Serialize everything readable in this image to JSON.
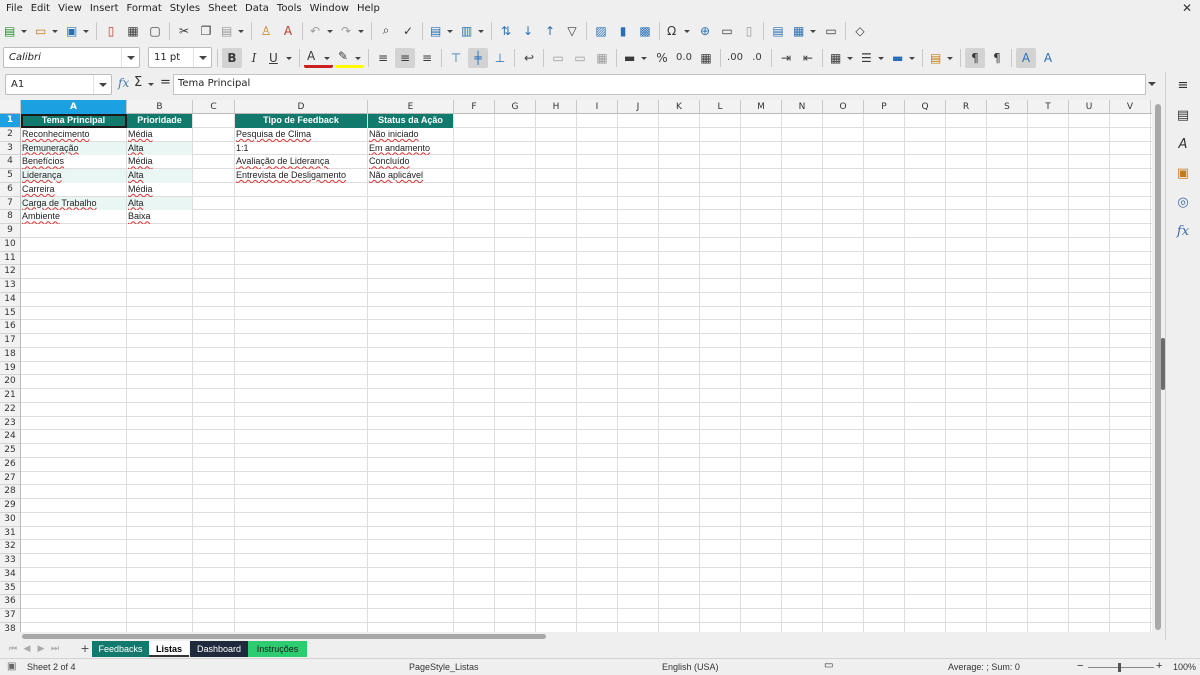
{
  "menu": [
    "File",
    "Edit",
    "View",
    "Insert",
    "Format",
    "Styles",
    "Sheet",
    "Data",
    "Tools",
    "Window",
    "Help"
  ],
  "close_glyph": "✕",
  "font": {
    "name": "Calibri",
    "size": "11 pt"
  },
  "name_box": "A1",
  "formula": {
    "fx": "fx",
    "sum": "Σ",
    "equals": "=",
    "content": "Tema Principal"
  },
  "columns": [
    "A",
    "B",
    "C",
    "D",
    "E",
    "F",
    "G",
    "H",
    "I",
    "J",
    "K",
    "L",
    "M",
    "N",
    "O",
    "P",
    "Q",
    "R",
    "S",
    "T",
    "U",
    "V"
  ],
  "row_count": 38,
  "selected": {
    "column": "A",
    "row": 1
  },
  "table1": {
    "headers": [
      "Tema Principal",
      "Prioridade"
    ],
    "rows": [
      [
        "Reconhecimento",
        "Média"
      ],
      [
        "Remuneração",
        "Alta"
      ],
      [
        "Benefícios",
        "Média"
      ],
      [
        "Liderança",
        "Alta"
      ],
      [
        "Carreira",
        "Média"
      ],
      [
        "Carga de Trabalho",
        "Alta"
      ],
      [
        "Ambiente",
        "Baixa"
      ]
    ]
  },
  "table2": {
    "headers": [
      "Tipo de Feedback",
      "Status da Ação"
    ],
    "rows": [
      [
        "Pesquisa de Clima",
        "Não iniciado"
      ],
      [
        "1:1",
        "Em andamento"
      ],
      [
        "Avaliação de Liderança",
        "Concluído"
      ],
      [
        "Entrevista de Desligamento",
        "Não aplicável"
      ]
    ]
  },
  "colors": {
    "header_fill": "#127a6d",
    "band_fill": "#eaf6f4",
    "selection": "#1ba1e2"
  },
  "sheet_tabs": [
    {
      "name": "Feedbacks",
      "bg": "#127a6d",
      "fg": "#ffffff",
      "active": false
    },
    {
      "name": "Listas",
      "bg": "#ffffff",
      "fg": "#000000",
      "active": true
    },
    {
      "name": "Dashboard",
      "bg": "#1f2a3c",
      "fg": "#ffffff",
      "active": false
    },
    {
      "name": "Instruções",
      "bg": "#2ecc71",
      "fg": "#1a1a1a",
      "active": false
    }
  ],
  "status": {
    "sheet": "Sheet 2 of 4",
    "page_style": "PageStyle_Listas",
    "language": "English (USA)",
    "summary": "Average: ; Sum: 0",
    "zoom": "100%"
  },
  "icons": {
    "toolbar1": [
      "new-document-icon",
      "open-folder-icon",
      "save-icon",
      "export-pdf-icon",
      "print-icon",
      "print-preview-icon",
      "cut-icon",
      "copy-icon",
      "paste-icon",
      "clone-formatting-icon",
      "clear-formatting-icon",
      "undo-icon",
      "redo-icon",
      "find-replace-icon",
      "spelling-icon",
      "row-icon",
      "column-icon",
      "sort-icon",
      "sort-ascending-icon",
      "sort-descending-icon",
      "autofilter-icon",
      "image-icon",
      "chart-icon",
      "pivot-table-icon",
      "special-character-icon",
      "hyperlink-icon",
      "comment-icon",
      "header-footer-icon",
      "define-print-area-icon",
      "freeze-rows-columns-icon",
      "split-window-icon",
      "show-draw-functions-icon"
    ],
    "toolbar2": [
      "bold-icon",
      "italic-icon",
      "underline-icon",
      "font-color-icon",
      "highlight-color-icon",
      "align-left-icon",
      "align-center-icon",
      "align-right-icon",
      "align-top-icon",
      "align-middle-icon",
      "align-bottom-icon",
      "wrap-text-icon",
      "merge-center-icon",
      "merge-cells-icon",
      "unmerge-cells-icon",
      "currency-format-icon",
      "percent-format-icon",
      "number-format-icon",
      "date-format-icon",
      "add-decimal-icon",
      "delete-decimal-icon",
      "increase-indent-icon",
      "decrease-indent-icon",
      "borders-icon",
      "border-style-icon",
      "border-color-icon",
      "conditional-format-icon",
      "text-direction-ltr-icon",
      "text-direction-rtl-icon",
      "text-direction-left-top-icon",
      "text-direction-top-left-icon"
    ],
    "sidebar": [
      "hamburger-menu-icon",
      "properties-icon",
      "styles-icon",
      "gallery-icon",
      "navigator-icon",
      "functions-icon"
    ]
  }
}
